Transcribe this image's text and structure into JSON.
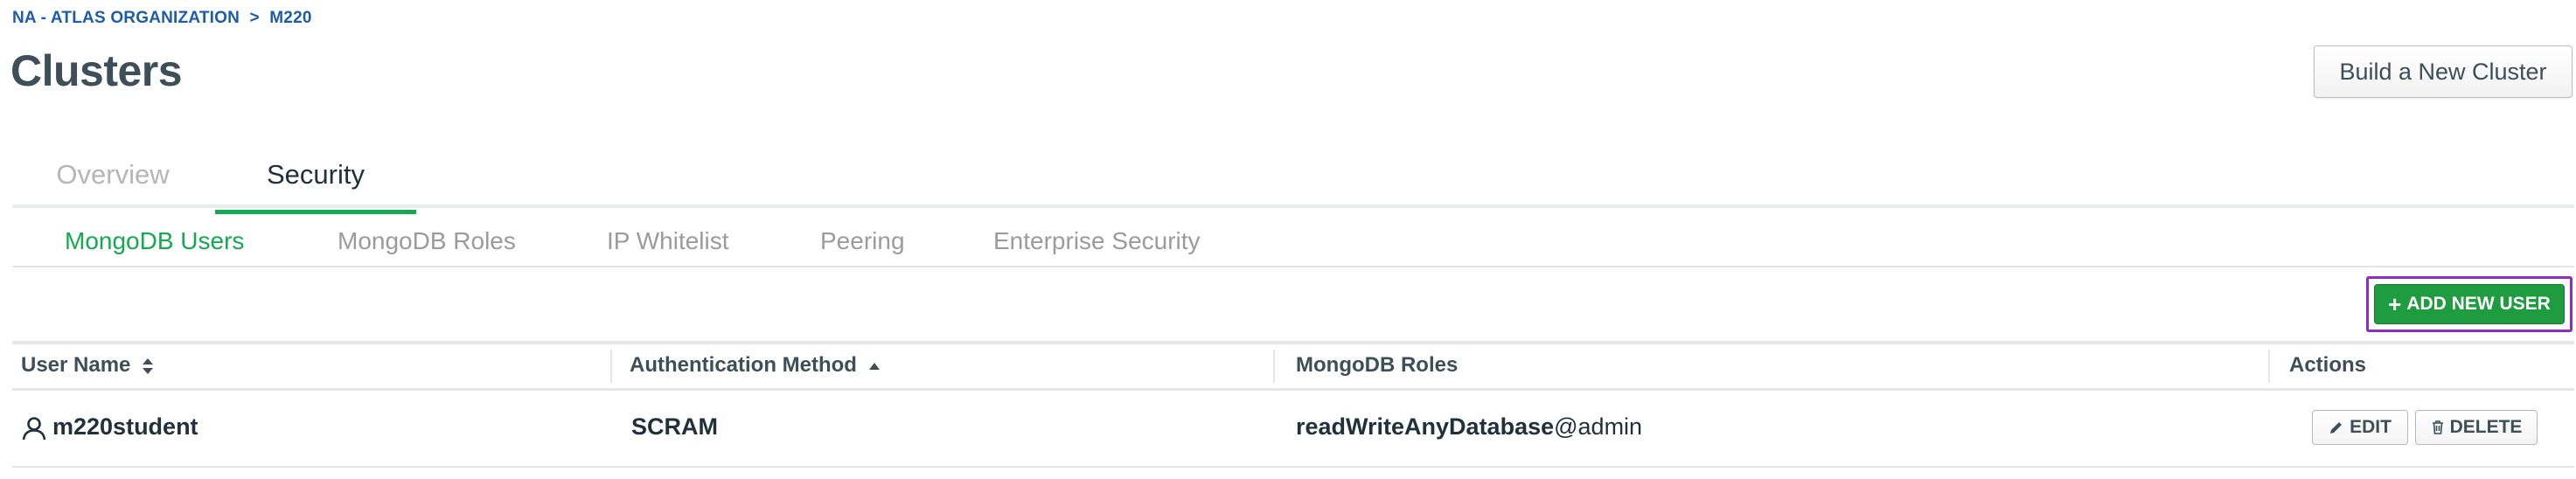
{
  "breadcrumb": {
    "org": "NA - ATLAS ORGANIZATION",
    "separator": ">",
    "project": "M220"
  },
  "page_title": "Clusters",
  "build_button": "Build a New Cluster",
  "main_tabs": [
    {
      "label": "Overview",
      "active": false
    },
    {
      "label": "Security",
      "active": true
    }
  ],
  "sub_tabs": [
    {
      "label": "MongoDB Users",
      "active": true
    },
    {
      "label": "MongoDB Roles",
      "active": false
    },
    {
      "label": "IP Whitelist",
      "active": false
    },
    {
      "label": "Peering",
      "active": false
    },
    {
      "label": "Enterprise Security",
      "active": false
    }
  ],
  "add_user_button": {
    "icon": "plus-icon",
    "label": "ADD NEW USER"
  },
  "table": {
    "headers": [
      {
        "label": "User Name",
        "sort": "both"
      },
      {
        "label": "Authentication Method",
        "sort": "ascending"
      },
      {
        "label": "MongoDB Roles",
        "sort": "none"
      },
      {
        "label": "Actions",
        "sort": "none"
      }
    ],
    "rows": [
      {
        "user": "m220student",
        "user_icon": "user-icon",
        "auth_method": "SCRAM",
        "role_name": "readWriteAnyDatabase",
        "role_db": "@admin",
        "actions": {
          "edit": "EDIT",
          "delete": "DELETE"
        }
      }
    ]
  },
  "colors": {
    "accent_green": "#13aa52",
    "button_green": "#1f9c3f",
    "highlight_purple": "#8e2dbf",
    "link_blue": "#1d5ca8"
  }
}
